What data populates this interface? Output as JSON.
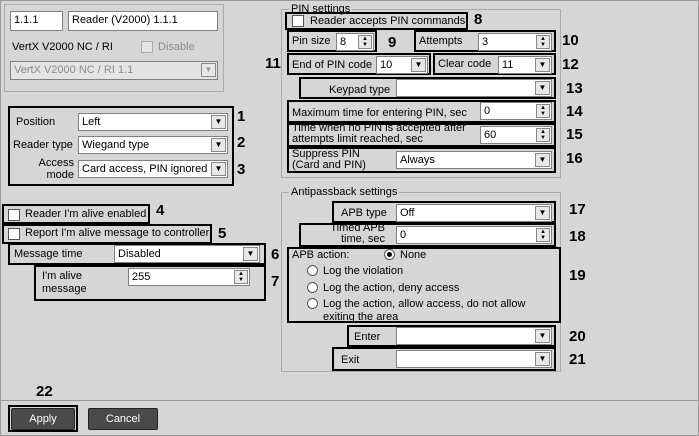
{
  "header": {
    "id_value": "1.1.1",
    "name_value": "Reader (V2000) 1.1.1",
    "device_label": "VertX V2000 NC / RI",
    "disable_label": "Disable",
    "device_select": "VertX V2000 NC / RI 1.1"
  },
  "left": {
    "position_label": "Position",
    "position_value": "Left",
    "reader_type_label": "Reader type",
    "reader_type_value": "Wiegand type",
    "access_mode_label": "Access mode",
    "access_mode_value": "Card access, PIN ignored",
    "alive_enabled_label": "Reader I'm alive enabled",
    "report_alive_label": "Report I'm alive message to controller",
    "message_time_label": "Message time",
    "message_time_value": "Disabled",
    "alive_message_label": "I'm alive message",
    "alive_message_value": "255"
  },
  "pin": {
    "group_title": "PIN settings",
    "accepts_label": "Reader accepts PIN commands",
    "pin_size_label": "Pin size",
    "pin_size_value": "8",
    "attempts_label": "Attempts",
    "attempts_value": "3",
    "end_label": "End of PIN code",
    "end_value": "10",
    "clear_label": "Clear code",
    "clear_value": "11",
    "keypad_label": "Keypad type",
    "keypad_value": "",
    "max_time_label": "Maximum time for entering PIN, sec",
    "max_time_value": "0",
    "no_pin_label": "Time when no PIN is accepted after attempts limit reached, sec",
    "no_pin_value": "60",
    "suppress_label": "Suppress PIN (Card and PIN)",
    "suppress_value": "Always"
  },
  "apb": {
    "group_title": "Antipassback settings",
    "type_label": "APB type",
    "type_value": "Off",
    "timed_label": "Timed APB time, sec",
    "timed_value": "0",
    "action_label": "APB action:",
    "option_none": "None",
    "option_1": "Log the violation",
    "option_2": "Log the action, deny access",
    "option_3": "Log the action, allow access, do not allow exiting the area",
    "enter_label": "Enter",
    "enter_value": "",
    "exit_label": "Exit",
    "exit_value": ""
  },
  "footer": {
    "apply_label": "Apply",
    "cancel_label": "Cancel"
  },
  "markers": [
    "1",
    "2",
    "3",
    "4",
    "5",
    "6",
    "7",
    "8",
    "9",
    "10",
    "11",
    "12",
    "13",
    "14",
    "15",
    "16",
    "17",
    "18",
    "19",
    "20",
    "21",
    "22"
  ]
}
